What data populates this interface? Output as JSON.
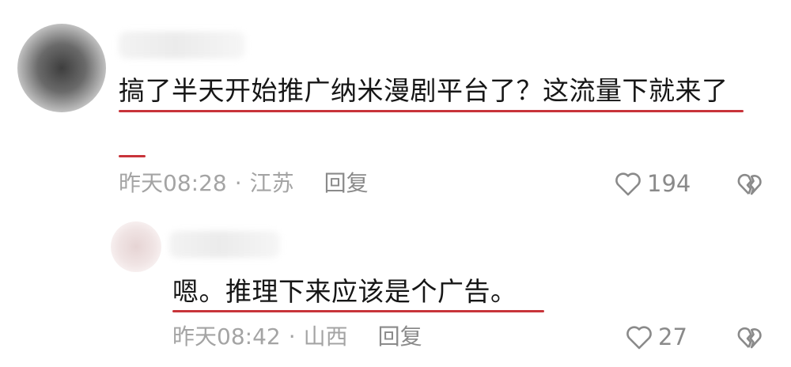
{
  "comments": [
    {
      "text": "搞了半天开始推广纳米漫剧平台了？这流量下就来了",
      "time": "昨天08:28",
      "separator": "·",
      "location": "江苏",
      "reply_label": "回复",
      "likes": "194",
      "like_icon": "heart-outline-icon",
      "dislike_icon": "broken-heart-icon"
    },
    {
      "text": "嗯。推理下来应该是个广告。",
      "time": "昨天08:42",
      "separator": "·",
      "location": "山西",
      "reply_label": "回复",
      "likes": "27",
      "like_icon": "heart-outline-icon",
      "dislike_icon": "broken-heart-icon"
    }
  ],
  "colors": {
    "text": "#161616",
    "meta": "#a4a4a4",
    "icon": "#8a8a8a",
    "annotation_underline": "#c8343a"
  }
}
